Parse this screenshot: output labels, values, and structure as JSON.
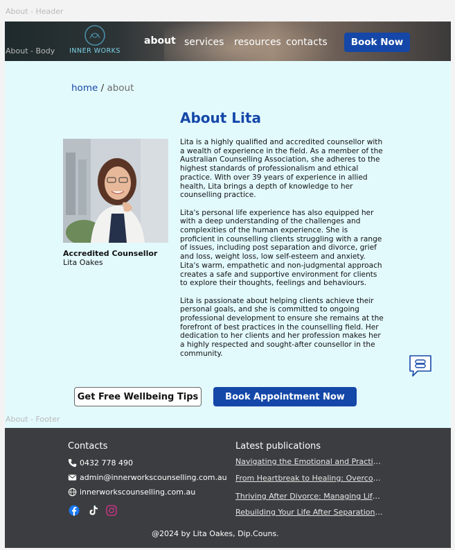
{
  "frame_labels": {
    "header": "About - Header",
    "body": "About - Body",
    "footer": "About - Footer"
  },
  "header": {
    "logo_text": "INNER WORKS",
    "nav": [
      {
        "label": "about",
        "active": true
      },
      {
        "label": "services",
        "active": false
      },
      {
        "label": "resources",
        "active": false
      },
      {
        "label": "contacts",
        "active": false
      }
    ],
    "book_button": "Book Now"
  },
  "breadcrumb": {
    "home": "home",
    "separator": "/",
    "current": "about"
  },
  "page_title": "About Lita",
  "profile": {
    "role": "Accredited Counsellor",
    "name": "Lita Oakes"
  },
  "bio": [
    "Lita is a highly qualified and accredited counsellor with a wealth of experience in the field. As a member of the Australian Counselling Association, she adheres to the highest standards of professionalism and ethical practice.  With over 39 years of experience in allied health, Lita brings a depth of knowledge to her counselling practice.",
    "Lita's personal life experience has also equipped her with a deep understanding of the challenges and complexities of the human experience. She is proficient in counselling clients struggling with a range of issues, including post separation and divorce, grief and loss, weight loss, low self-esteem and anxiety. Lita's warm, empathetic and non-judgmental approach creates a safe and supportive environment for clients to explore their thoughts, feelings and behaviours.",
    "Lita is passionate about helping clients achieve their personal goals, and she is committed to ongoing professional development to ensure she remains at the forefront of best practices in the counselling field.  Her dedication to her clients and her profession makes her a highly respected and sought-after counsellor in the community."
  ],
  "cta": {
    "tips": "Get Free Wellbeing Tips",
    "appointment": "Book Appointment Now"
  },
  "footer": {
    "contacts_heading": "Contacts",
    "phone": "0432 778 490",
    "email": "admin@innerworkscounselling.com.au",
    "website": "innerworkscounselling.com.au",
    "publications_heading": "Latest publications",
    "publications": [
      "Navigating the Emotional and Practical Challenges of Separation",
      "From Heartbreak to Healing: Overcoming Grief After Divorce",
      "Thriving After Divorce: Managing Life Changes",
      "Rebuilding Your Life After Separation: A Guide"
    ],
    "copyright": "@2024 by Lita Oakes, Dip.Couns."
  },
  "colors": {
    "brand_blue": "#1447a8",
    "body_bg": "#e3fafd",
    "footer_bg": "#3c3d40"
  }
}
